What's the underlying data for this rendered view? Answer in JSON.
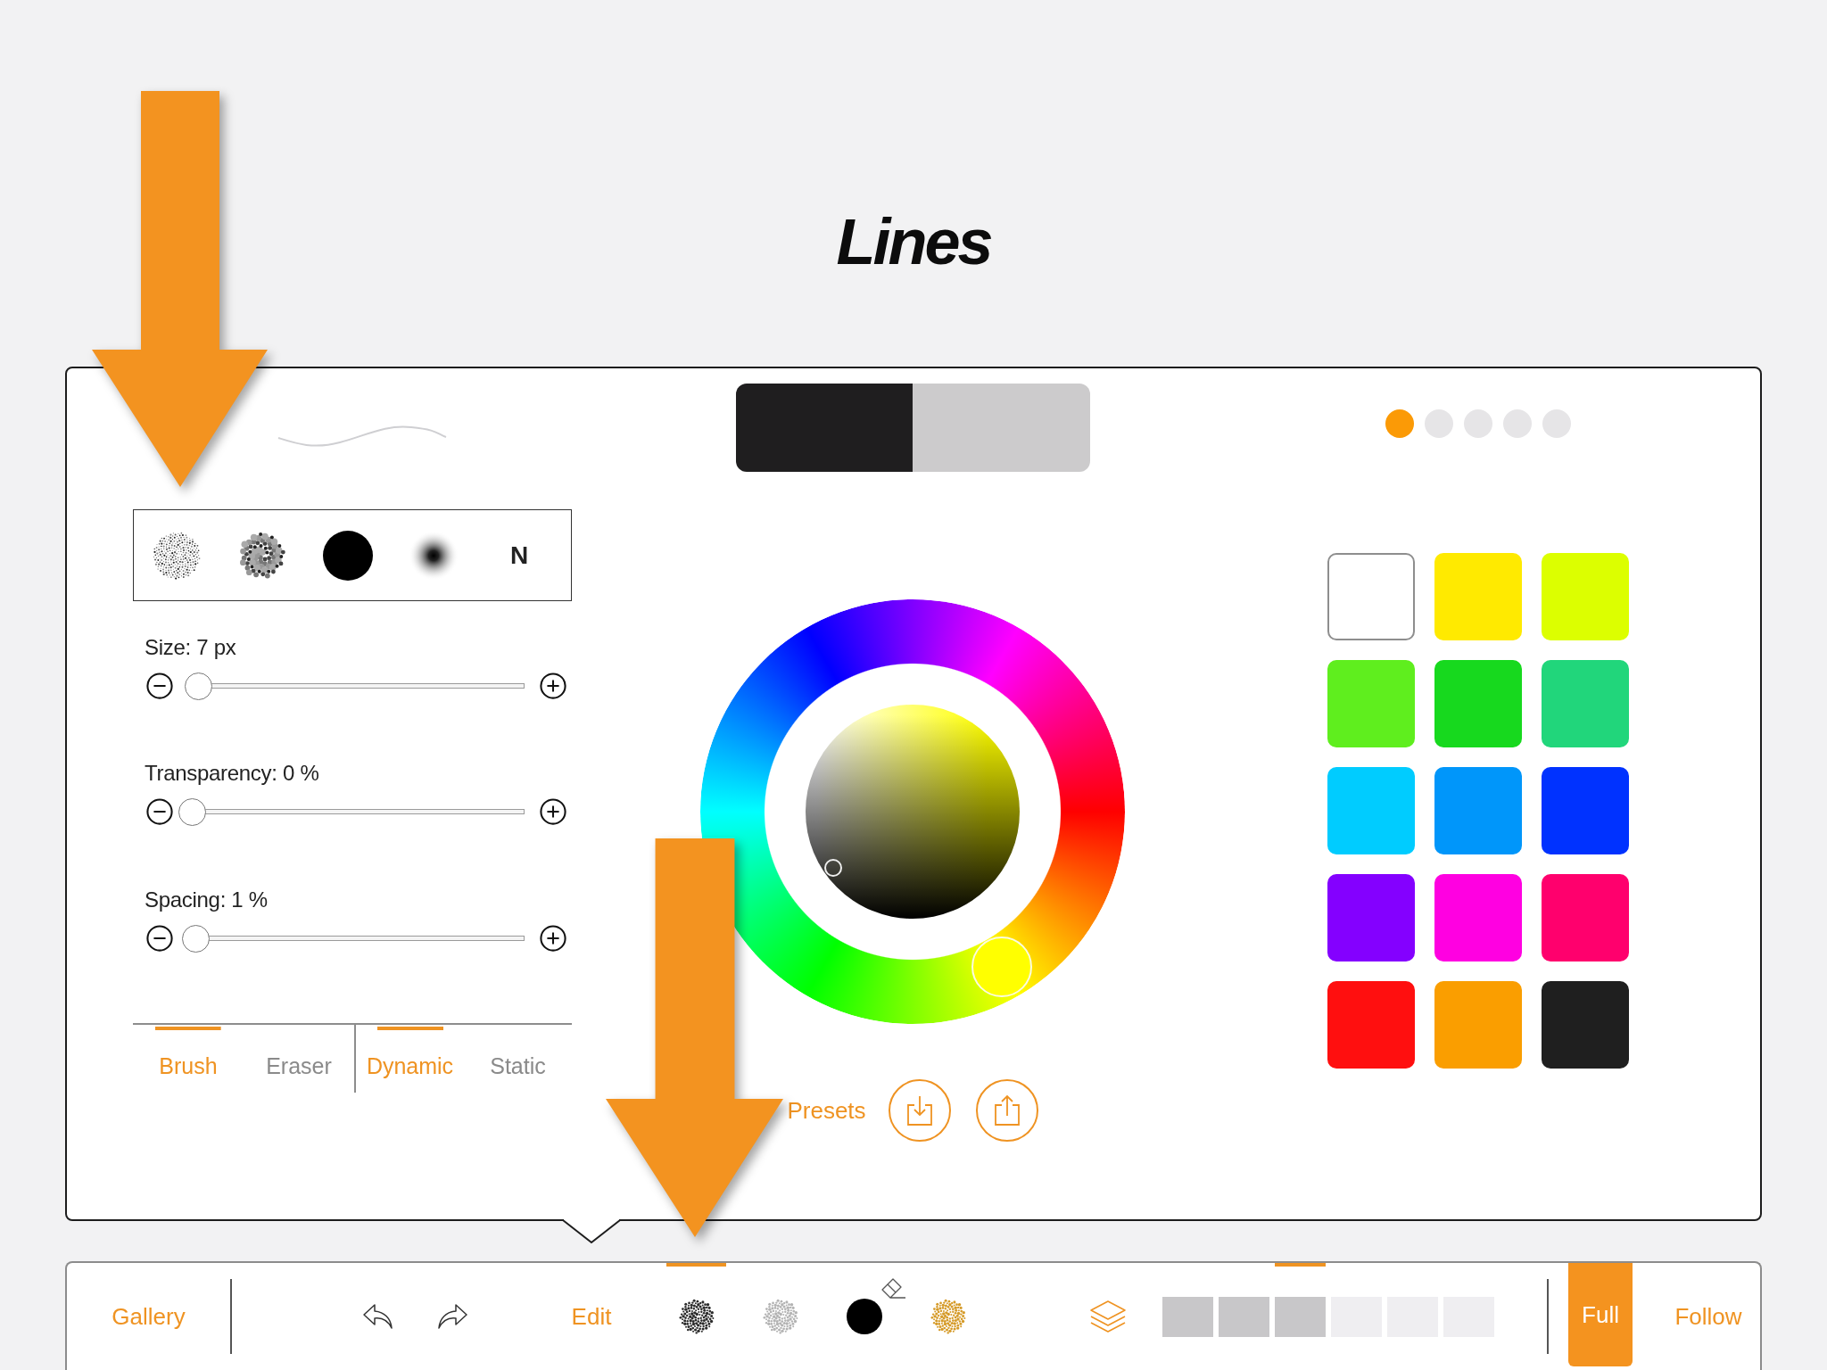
{
  "title": "Lines",
  "panel": {
    "color_preview": [
      {
        "color": "#1f1e1f"
      },
      {
        "color": "#cccbcc"
      }
    ],
    "pages": [
      {
        "selected": true
      },
      {
        "selected": false
      },
      {
        "selected": false
      },
      {
        "selected": false
      },
      {
        "selected": false
      }
    ],
    "brushes": [
      {
        "kind": "spray"
      },
      {
        "kind": "clumpy"
      },
      {
        "kind": "solid"
      },
      {
        "kind": "soft"
      },
      {
        "kind": "letter",
        "label": "N"
      }
    ],
    "sliders": [
      {
        "label": "Size: 7 px",
        "level": 0.02
      },
      {
        "label": "Transparency: 0 %",
        "level": 0
      },
      {
        "label": "Spacing: 1 %",
        "level": 0.01
      }
    ],
    "tool_tabs": [
      {
        "label": "Brush",
        "selected": true
      },
      {
        "label": "Eraser",
        "selected": false
      }
    ],
    "mode_tabs": [
      {
        "label": "Dynamic",
        "selected": true
      },
      {
        "label": "Static",
        "selected": false
      }
    ],
    "presets_label": "Presets",
    "swatches": [
      {
        "color": "#ffffff"
      },
      {
        "color": "#ffea00"
      },
      {
        "color": "#dcff00"
      },
      {
        "color": "#5fee1e"
      },
      {
        "color": "#17d91e"
      },
      {
        "color": "#21d67b"
      },
      {
        "color": "#00ccff"
      },
      {
        "color": "#0096fa"
      },
      {
        "color": "#0032ff"
      },
      {
        "color": "#8400ff"
      },
      {
        "color": "#ff00e1"
      },
      {
        "color": "#ff006d"
      },
      {
        "color": "#ff0f0f"
      },
      {
        "color": "#fa9e00"
      },
      {
        "color": "#1f1f1f"
      }
    ]
  },
  "toolbar": {
    "gallery": "Gallery",
    "edit": "Edit",
    "brushes": [
      {
        "kind": "spray",
        "color": "#2b2b2b",
        "selected": true,
        "eraser": false
      },
      {
        "kind": "spray",
        "color": "#b3b3b3",
        "selected": false,
        "eraser": false
      },
      {
        "kind": "solid",
        "color": "#000000",
        "selected": false,
        "eraser": true
      },
      {
        "kind": "spray",
        "color": "#d59a28",
        "selected": false,
        "eraser": false
      }
    ],
    "layers": [
      {
        "empty": false,
        "selected": false
      },
      {
        "empty": false,
        "selected": false
      },
      {
        "empty": false,
        "selected": true
      },
      {
        "empty": true,
        "selected": false
      },
      {
        "empty": true,
        "selected": false
      },
      {
        "empty": true,
        "selected": false
      }
    ],
    "view_modes": [
      {
        "label": "Full",
        "selected": true
      },
      {
        "label": "Follow",
        "selected": false
      }
    ]
  }
}
